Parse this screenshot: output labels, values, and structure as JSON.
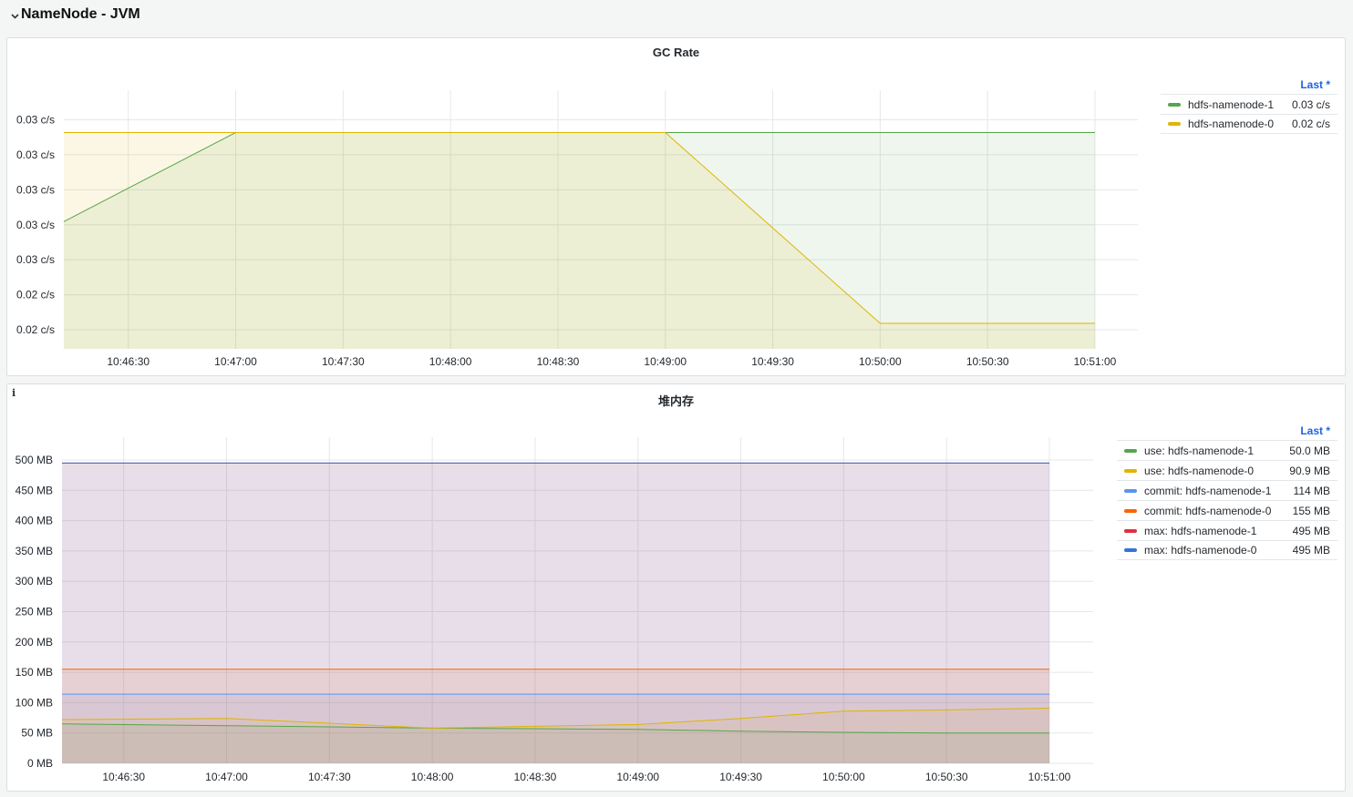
{
  "row": {
    "title": "NameNode - JVM"
  },
  "colors": {
    "green": "#56a64b",
    "yellow": "#e0b400",
    "light_blue": "#5794f2",
    "orange": "#fa6400",
    "red": "#e02f44",
    "blue": "#3274d9",
    "legend_header": "#1f62e0"
  },
  "gc_panel": {
    "title": "GC Rate",
    "legend_header": "Last *",
    "legend": [
      {
        "name": "hdfs-namenode-1",
        "value": "0.03 c/s",
        "color": "#56a64b"
      },
      {
        "name": "hdfs-namenode-0",
        "value": "0.02 c/s",
        "color": "#e0b400"
      }
    ]
  },
  "heap_panel": {
    "title": "堆内存",
    "info_icon": "info-icon",
    "legend_header": "Last *",
    "legend": [
      {
        "name": "use: hdfs-namenode-1",
        "value": "50.0 MB",
        "color": "#56a64b"
      },
      {
        "name": "use: hdfs-namenode-0",
        "value": "90.9 MB",
        "color": "#e0b400"
      },
      {
        "name": "commit: hdfs-namenode-1",
        "value": "114 MB",
        "color": "#5794f2"
      },
      {
        "name": "commit: hdfs-namenode-0",
        "value": "155 MB",
        "color": "#fa6400"
      },
      {
        "name": "max: hdfs-namenode-1",
        "value": "495 MB",
        "color": "#e02f44"
      },
      {
        "name": "max: hdfs-namenode-0",
        "value": "495 MB",
        "color": "#3274d9"
      }
    ]
  },
  "chart_data": [
    {
      "type": "area",
      "title": "GC Rate",
      "x_ticks": [
        "10:46:30",
        "10:47:00",
        "10:47:30",
        "10:48:00",
        "10:48:30",
        "10:49:00",
        "10:49:30",
        "10:50:00",
        "10:50:30",
        "10:51:00"
      ],
      "y_tick_labels": [
        "0.03 c/s",
        "0.03 c/s",
        "0.03 c/s",
        "0.03 c/s",
        "0.03 c/s",
        "0.02 c/s",
        "0.02 c/s"
      ],
      "y_tick_values": [
        0.0297,
        0.0286,
        0.0275,
        0.0264,
        0.0253,
        0.0242,
        0.0231
      ],
      "ylim": [
        0.0225,
        0.0302
      ],
      "x_range_seconds": [
        -18,
        270
      ],
      "x_tick_seconds": [
        0,
        30,
        60,
        90,
        120,
        150,
        180,
        210,
        240,
        270
      ],
      "series": [
        {
          "name": "hdfs-namenode-1",
          "color": "#56a64b",
          "x": [
            -18,
            30,
            150,
            180,
            210,
            240,
            270
          ],
          "y": [
            0.0265,
            0.0293,
            0.0293,
            0.0293,
            0.0293,
            0.0293,
            0.0293
          ]
        },
        {
          "name": "hdfs-namenode-0",
          "color": "#e0b400",
          "x": [
            -18,
            30,
            150,
            180,
            210,
            240,
            270
          ],
          "y": [
            0.0293,
            0.0293,
            0.0293,
            0.0263,
            0.0233,
            0.0233,
            0.0233
          ]
        }
      ]
    },
    {
      "type": "area",
      "title": "堆内存",
      "x_ticks": [
        "10:46:30",
        "10:47:00",
        "10:47:30",
        "10:48:00",
        "10:48:30",
        "10:49:00",
        "10:49:30",
        "10:50:00",
        "10:50:30",
        "10:51:00"
      ],
      "y_tick_labels": [
        "0 MB",
        "50 MB",
        "100 MB",
        "150 MB",
        "200 MB",
        "250 MB",
        "300 MB",
        "350 MB",
        "400 MB",
        "450 MB",
        "500 MB"
      ],
      "y_tick_values": [
        0,
        50,
        100,
        150,
        200,
        250,
        300,
        350,
        400,
        450,
        500
      ],
      "ylim": [
        0,
        500
      ],
      "x_range_seconds": [
        -18,
        270
      ],
      "x_tick_seconds": [
        0,
        30,
        60,
        90,
        120,
        150,
        180,
        210,
        240,
        270
      ],
      "series": [
        {
          "name": "use: hdfs-namenode-1",
          "color": "#56a64b",
          "x": [
            -18,
            30,
            60,
            90,
            120,
            150,
            180,
            210,
            240,
            270
          ],
          "y": [
            65,
            62,
            60,
            58,
            57,
            56,
            53,
            51,
            50,
            50
          ]
        },
        {
          "name": "use: hdfs-namenode-0",
          "color": "#e0b400",
          "x": [
            -18,
            30,
            60,
            90,
            120,
            150,
            180,
            210,
            240,
            270
          ],
          "y": [
            72,
            74,
            66,
            58,
            61,
            64,
            74,
            86,
            88,
            90.9
          ]
        },
        {
          "name": "commit: hdfs-namenode-1",
          "color": "#5794f2",
          "x": [
            -18,
            270
          ],
          "y": [
            114,
            114
          ]
        },
        {
          "name": "commit: hdfs-namenode-0",
          "color": "#fa6400",
          "x": [
            -18,
            270
          ],
          "y": [
            155,
            155
          ]
        },
        {
          "name": "max: hdfs-namenode-1",
          "color": "#e02f44",
          "x": [
            -18,
            270
          ],
          "y": [
            495,
            495
          ]
        },
        {
          "name": "max: hdfs-namenode-0",
          "color": "#3274d9",
          "x": [
            -18,
            270
          ],
          "y": [
            495,
            495
          ]
        }
      ]
    }
  ]
}
